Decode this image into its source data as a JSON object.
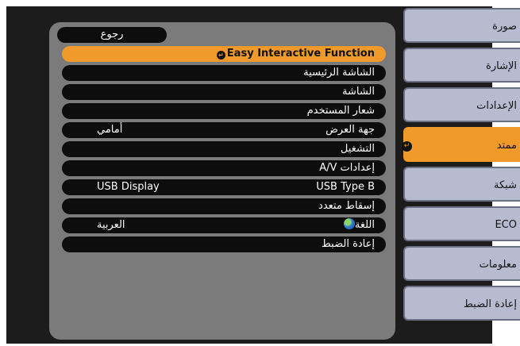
{
  "menu": {
    "back_label": "رجوع",
    "rows": [
      {
        "label": "Easy Interactive Function",
        "value": "",
        "selected": true,
        "latin": true,
        "has_enter": true,
        "has_globe": false
      },
      {
        "label": "الشاشة الرئيسية",
        "value": "",
        "selected": false,
        "latin": false,
        "has_enter": false,
        "has_globe": false
      },
      {
        "label": "الشاشة",
        "value": "",
        "selected": false,
        "latin": false,
        "has_enter": false,
        "has_globe": false
      },
      {
        "label": "شعار المستخدم",
        "value": "",
        "selected": false,
        "latin": false,
        "has_enter": false,
        "has_globe": false
      },
      {
        "label": "جهة العرض",
        "value": "أمامي",
        "selected": false,
        "latin": false,
        "has_enter": false,
        "has_globe": false
      },
      {
        "label": "التشغيل",
        "value": "",
        "selected": false,
        "latin": false,
        "has_enter": false,
        "has_globe": false
      },
      {
        "label": "إعدادات A/V",
        "value": "",
        "selected": false,
        "latin": false,
        "has_enter": false,
        "has_globe": false
      },
      {
        "label": "USB Type B",
        "value": "USB Display",
        "selected": false,
        "latin": false,
        "has_enter": false,
        "has_globe": false
      },
      {
        "label": "إسقاط متعدد",
        "value": "",
        "selected": false,
        "latin": false,
        "has_enter": false,
        "has_globe": false
      },
      {
        "label": "اللغة",
        "value": "العربية",
        "selected": false,
        "latin": false,
        "has_enter": false,
        "has_globe": true
      },
      {
        "label": "إعادة الضبط",
        "value": "",
        "selected": false,
        "latin": false,
        "has_enter": false,
        "has_globe": false
      }
    ]
  },
  "tabs": [
    {
      "label": "صورة",
      "active": false
    },
    {
      "label": "الإشارة",
      "active": false
    },
    {
      "label": "الإعدادات",
      "active": false
    },
    {
      "label": "ممتد",
      "active": true
    },
    {
      "label": "شبكة",
      "active": false
    },
    {
      "label": "ECO",
      "active": false
    },
    {
      "label": "معلومات",
      "active": false
    },
    {
      "label": "إعادة الضبط",
      "active": false
    }
  ],
  "colors": {
    "accent": "#ef9a2b",
    "row_bg": "#0d0d0d",
    "panel_bg": "#7b7b7b",
    "tab_bg": "#b7bbd0"
  },
  "icons": {
    "enter": "enter-icon",
    "language": "globe-icon"
  }
}
